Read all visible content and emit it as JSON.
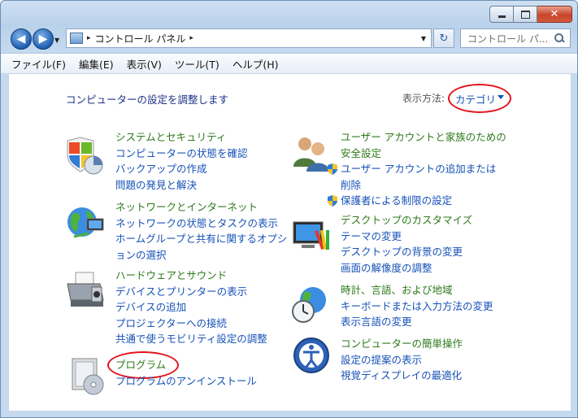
{
  "window": {
    "minimize": "",
    "maximize": "",
    "close": "✕"
  },
  "nav": {
    "back": "◀",
    "forward": "▶",
    "dropdown": "▼",
    "refresh": "↻"
  },
  "address": {
    "separator1": "▸",
    "location": "コントロール パネル",
    "separator2": "▸",
    "dropdown": "▼"
  },
  "search": {
    "placeholder": "コントロール パ..."
  },
  "menu": [
    "ファイル(F)",
    "編集(E)",
    "表示(V)",
    "ツール(T)",
    "ヘルプ(H)"
  ],
  "content": {
    "heading": "コンピューターの設定を調整します",
    "view_by_label": "表示方法:",
    "view_by_value": "カテゴリ"
  },
  "categories": [
    {
      "title": "システムとセキュリティ",
      "links": [
        "コンピューターの状態を確認",
        "バックアップの作成",
        "問題の発見と解決"
      ],
      "icon": "shield-icon"
    },
    {
      "title": "ネットワークとインターネット",
      "links": [
        "ネットワークの状態とタスクの表示",
        "ホームグループと共有に関するオプシ",
        "ョンの選択"
      ],
      "icon": "network-globe-icon"
    },
    {
      "title": "ハードウェアとサウンド",
      "links": [
        "デバイスとプリンターの表示",
        "デバイスの追加",
        "プロジェクターへの接続",
        "共通で使うモビリティ設定の調整"
      ],
      "icon": "printer-icon"
    },
    {
      "title": "プログラム",
      "links": [
        "プログラムのアンインストール"
      ],
      "icon": "programs-icon"
    },
    {
      "title": "ユーザー アカウントと家族のための",
      "title2": "安全設定",
      "links": [
        "ユーザー アカウントの追加または",
        "削除",
        "保護者による制限の設定"
      ],
      "icon": "users-icon"
    },
    {
      "title": "デスクトップのカスタマイズ",
      "links": [
        "テーマの変更",
        "デスクトップの背景の変更",
        "画面の解像度の調整"
      ],
      "icon": "desktop-palette-icon"
    },
    {
      "title": "時計、言語、および地域",
      "links": [
        "キーボードまたは入力方法の変更",
        "表示言語の変更"
      ],
      "icon": "clock-globe-icon"
    },
    {
      "title": "コンピューターの簡単操作",
      "links": [
        "設定の提案の表示",
        "視覚ディスプレイの最適化"
      ],
      "icon": "ease-of-access-icon"
    }
  ]
}
